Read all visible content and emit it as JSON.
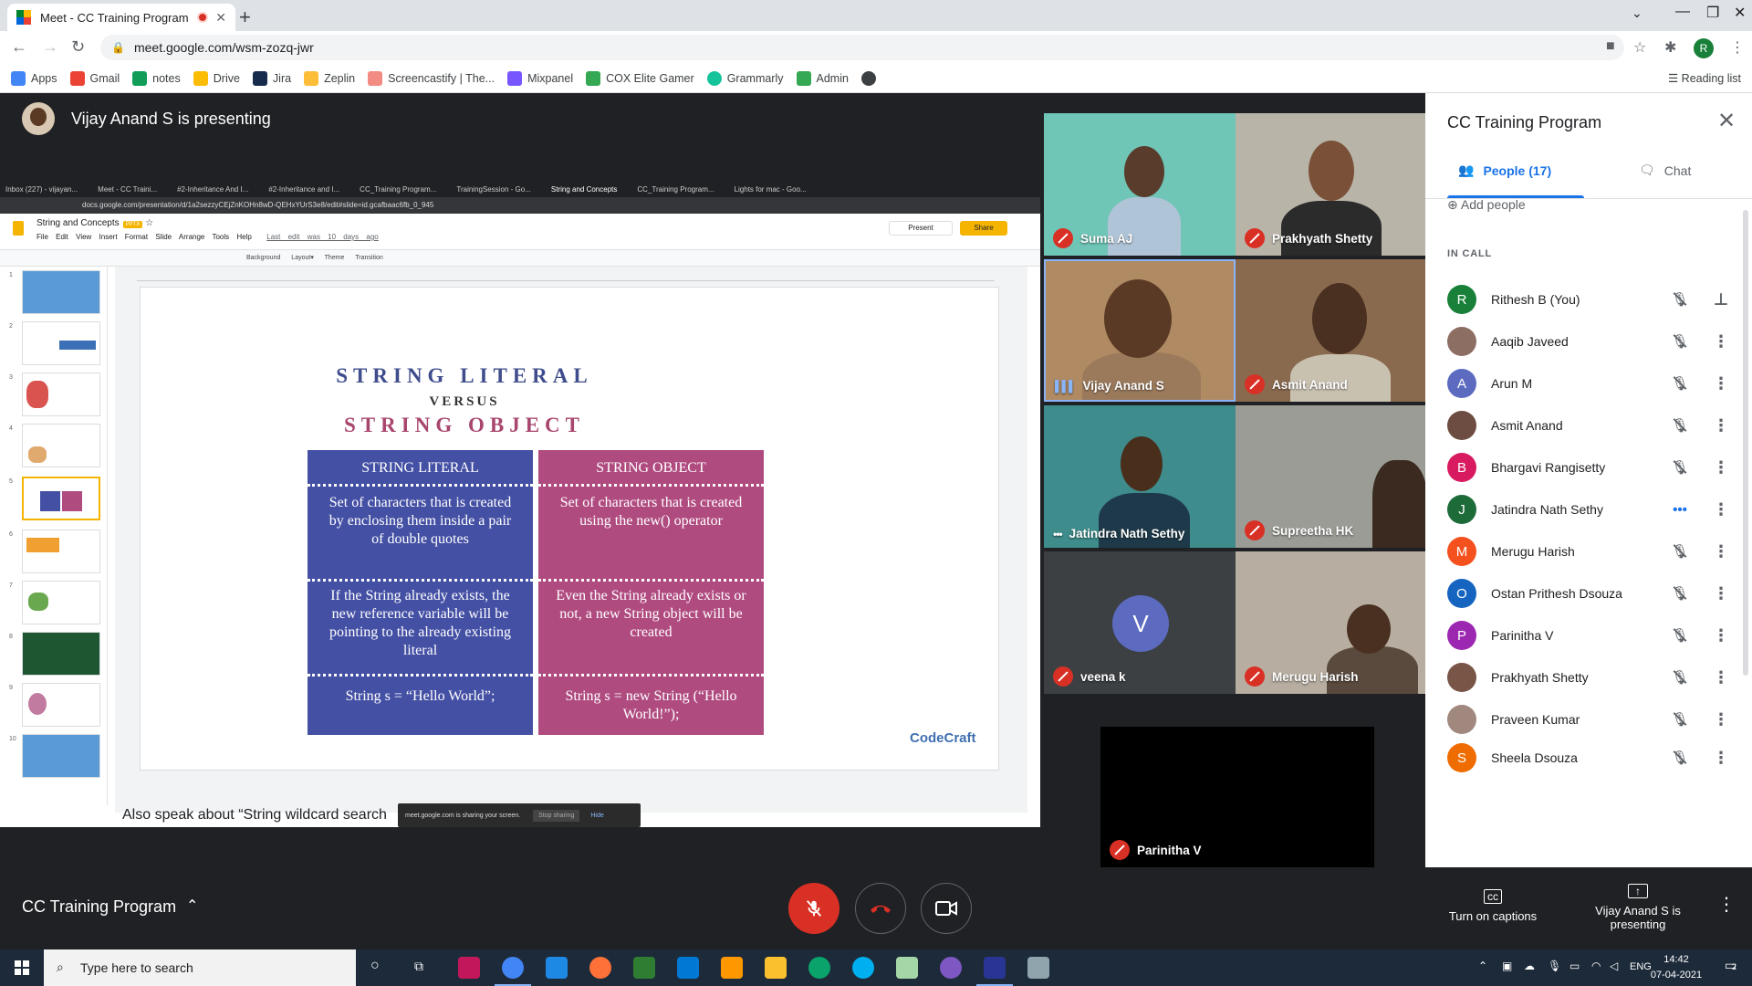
{
  "browser": {
    "tab_title": "Meet - CC Training Program",
    "url": "meet.google.com/wsm-zozq-jwr",
    "bookmarks": [
      "Apps",
      "Gmail",
      "notes",
      "Drive",
      "Jira",
      "Zeplin",
      "Screencastify | The...",
      "Mixpanel",
      "COX Elite Gamer",
      "Grammarly",
      "Admin"
    ],
    "reading_list": "Reading list",
    "profile_initial": "R"
  },
  "stage": {
    "presenting_banner": "Vijay Anand S is presenting"
  },
  "shared_screen": {
    "tabs": [
      "Inbox (227) - vijayan...",
      "Meet - CC Traini...",
      "#2-Inheritance And I...",
      "#2-Inheritance and I...",
      "CC_Training Program...",
      "TrainingSession - Go...",
      "String and Concepts",
      "CC_Training Program...",
      "Lights for mac - Goo..."
    ],
    "url": "docs.google.com/presentation/d/1a2sezzyCEjZnKOHn8wD-QEHxYUrS3e8/edit#slide=id.gcafbaac6fb_0_945",
    "doc_name": "String and Concepts",
    "doc_badge": "PPTX",
    "menus": "File Edit View Insert Format Slide Arrange Tools Help",
    "last_edit": "Last edit was 10 days ago",
    "present_label": "Present",
    "share_label": "Share",
    "toolbar_text": "Background  Layout▾  Theme  Transition",
    "thumb_numbers": [
      "1",
      "2",
      "3",
      "4",
      "5",
      "6",
      "7",
      "8",
      "9",
      "10"
    ],
    "selected_thumb": 5,
    "slide": {
      "title1": "STRING LITERAL",
      "versus": "VERSUS",
      "title2": "STRING OBJECT",
      "left": {
        "header": "STRING LITERAL",
        "row1": "Set of characters that is created by enclosing them inside a pair of double quotes",
        "row2": "If the String already exists, the new reference variable will be pointing to the already existing literal",
        "row3": "String s = “Hello World”;"
      },
      "right": {
        "header": "STRING OBJECT",
        "row1": "Set of characters that is created using the new() operator",
        "row2": "Even the String already exists or not, a new String object will be created",
        "row3": "String s = new String (“Hello World!”);"
      },
      "logo": "CodeCraft"
    },
    "speaker_notes": "Also speak about “String wildcard search",
    "share_bar": {
      "message": "meet.google.com is sharing your screen.",
      "stop": "Stop sharing",
      "hide": "Hide"
    }
  },
  "tiles": [
    {
      "name": "Suma AJ",
      "status": "muted"
    },
    {
      "name": "Prakhyath Shetty",
      "status": "muted"
    },
    {
      "name": "Vijay Anand S",
      "status": "speaking"
    },
    {
      "name": "Asmit Anand",
      "status": "muted"
    },
    {
      "name": "Jatindra Nath Sethy",
      "status": "more"
    },
    {
      "name": "Supreetha HK",
      "status": "muted"
    },
    {
      "name": "veena k",
      "status": "muted",
      "initial": "V"
    },
    {
      "name": "Merugu Harish",
      "status": "muted"
    },
    {
      "name": "Parinitha V",
      "status": "muted"
    }
  ],
  "panel": {
    "title": "CC Training Program",
    "people_tab": "People (17)",
    "chat_tab": "Chat",
    "add_people": "Add people",
    "in_call": "IN CALL",
    "people": [
      {
        "name": "Rithesh B (You)",
        "initial": "R",
        "color": "#188038"
      },
      {
        "name": "Aaqib Javeed",
        "initial": "",
        "color": "#8d6e63"
      },
      {
        "name": "Arun M",
        "initial": "A",
        "color": "#5c6bc0"
      },
      {
        "name": "Asmit Anand",
        "initial": "",
        "color": "#6d4c41"
      },
      {
        "name": "Bhargavi Rangisetty",
        "initial": "B",
        "color": "#d81b60"
      },
      {
        "name": "Jatindra Nath Sethy",
        "initial": "J",
        "color": "#1e6b3a"
      },
      {
        "name": "Merugu Harish",
        "initial": "M",
        "color": "#f4511e"
      },
      {
        "name": "Ostan Prithesh Dsouza",
        "initial": "O",
        "color": "#1565c0"
      },
      {
        "name": "Parinitha V",
        "initial": "P",
        "color": "#9c27b0"
      },
      {
        "name": "Prakhyath Shetty",
        "initial": "",
        "color": "#795548"
      },
      {
        "name": "Praveen Kumar",
        "initial": "",
        "color": "#a1887f"
      },
      {
        "name": "Sheela Dsouza",
        "initial": "S",
        "color": "#ef6c00"
      }
    ]
  },
  "bottom_bar": {
    "meeting_name": "CC Training Program",
    "captions_label": "Turn on captions",
    "presenting_label": "Vijay Anand S is presenting"
  },
  "taskbar": {
    "search_placeholder": "Type here to search",
    "lang": "ENG",
    "time": "14:42",
    "date": "07-04-2021",
    "notif_count": "2"
  }
}
